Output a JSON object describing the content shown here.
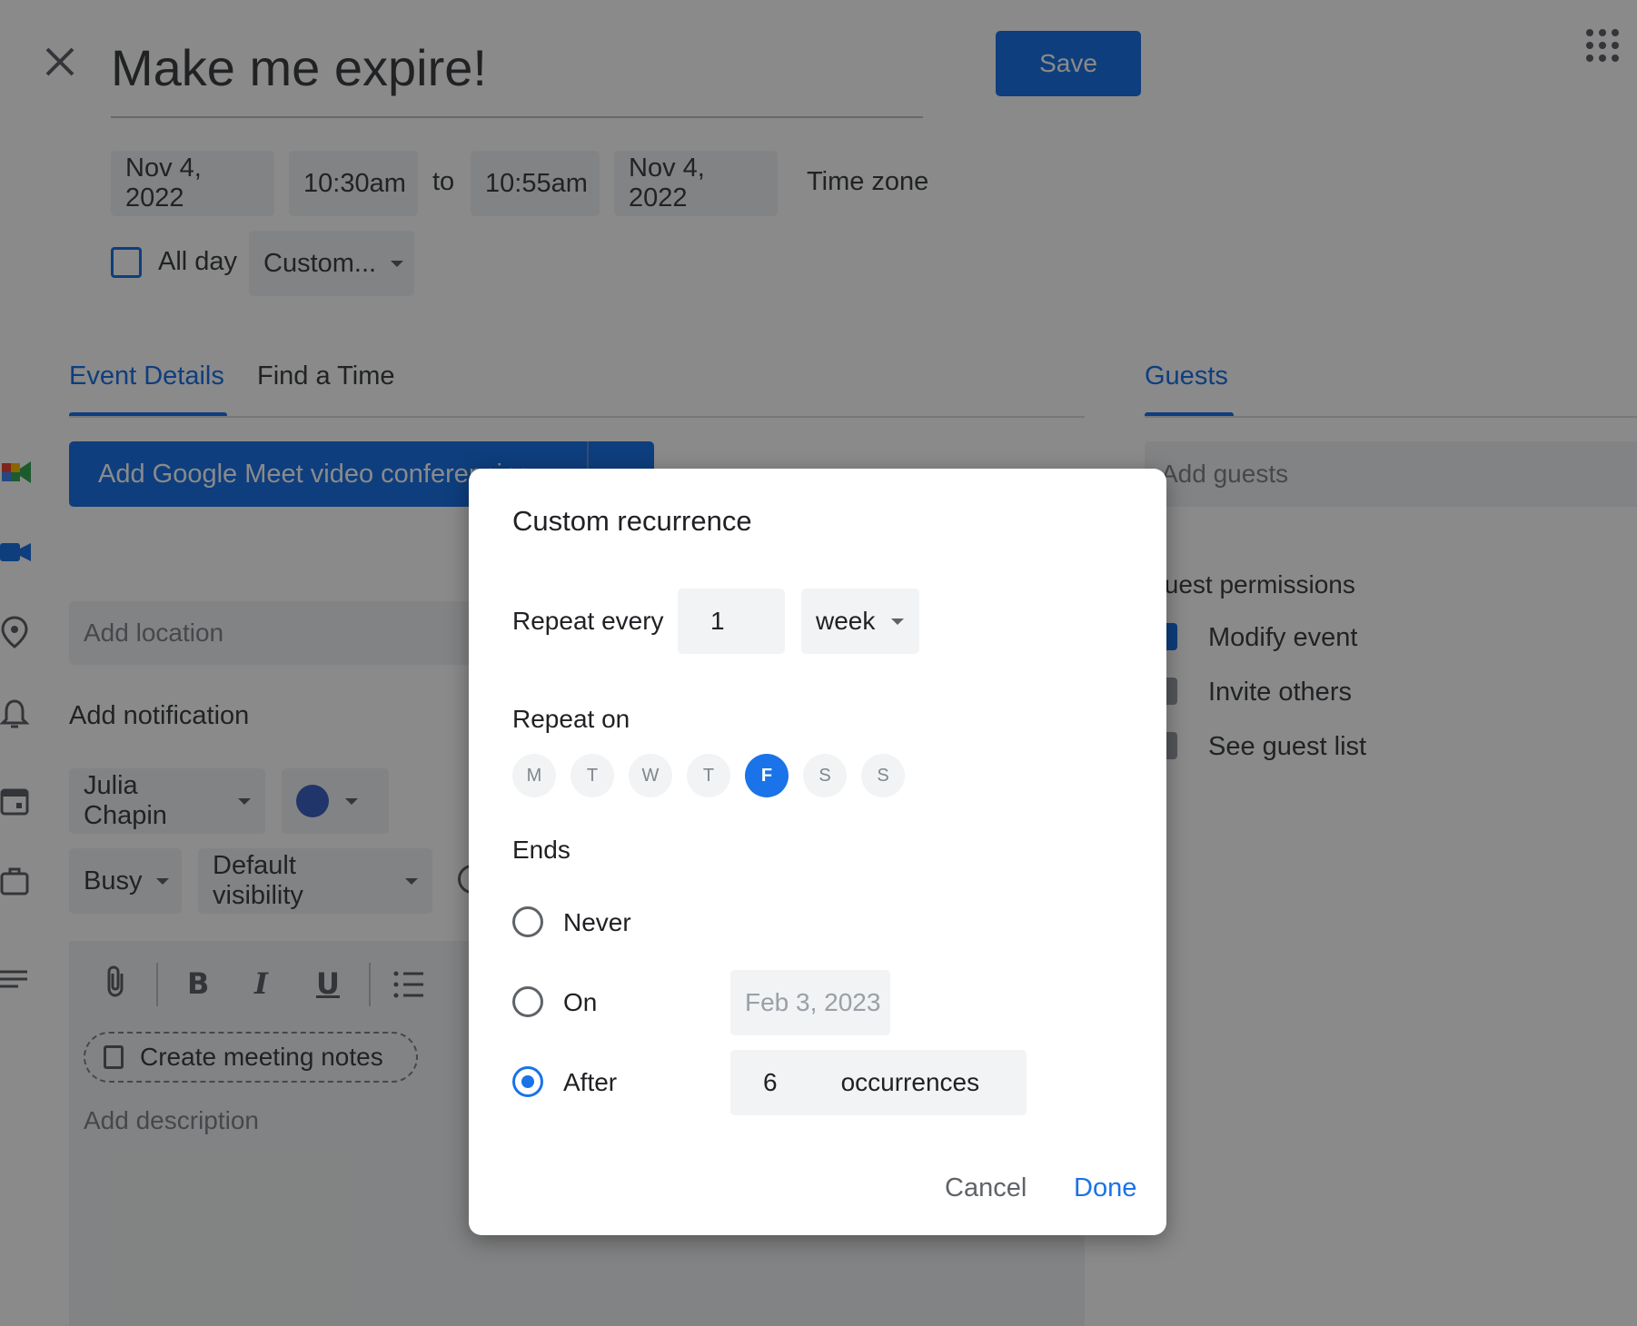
{
  "event": {
    "title": "Make me expire!",
    "save_label": "Save",
    "start_date": "Nov 4, 2022",
    "start_time": "10:30am",
    "to_label": "to",
    "end_time": "10:55am",
    "end_date": "Nov 4, 2022",
    "timezone_label": "Time zone",
    "all_day_label": "All day",
    "recurrence_value": "Custom..."
  },
  "tabs": {
    "event_details": "Event Details",
    "find_a_time": "Find a Time",
    "guests": "Guests"
  },
  "details": {
    "meet_button": "Add Google Meet video conferencing",
    "location_placeholder": "Add location",
    "notification_label": "Add notification",
    "calendar_owner": "Julia Chapin",
    "calendar_color": "#3b63c4",
    "availability": "Busy",
    "visibility": "Default visibility",
    "meeting_notes": "Create meeting notes",
    "description_placeholder": "Add description"
  },
  "guests": {
    "add_placeholder": "Add guests",
    "permissions_title": "Guest permissions",
    "permissions": [
      "Modify event",
      "Invite others",
      "See guest list"
    ]
  },
  "dialog": {
    "title": "Custom recurrence",
    "repeat_every_label": "Repeat every",
    "repeat_interval": "1",
    "repeat_unit": "week",
    "repeat_on_label": "Repeat on",
    "days": [
      {
        "letter": "M",
        "selected": false
      },
      {
        "letter": "T",
        "selected": false
      },
      {
        "letter": "W",
        "selected": false
      },
      {
        "letter": "T",
        "selected": false
      },
      {
        "letter": "F",
        "selected": true
      },
      {
        "letter": "S",
        "selected": false
      },
      {
        "letter": "S",
        "selected": false
      }
    ],
    "ends_label": "Ends",
    "ends_never": "Never",
    "ends_on": "On",
    "ends_on_date": "Feb 3, 2023",
    "ends_after": "After",
    "occurrences_count": "6",
    "occurrences_label": "occurrences",
    "selected_end": "After",
    "cancel_label": "Cancel",
    "done_label": "Done"
  },
  "colors": {
    "accent": "#1a73e8",
    "overlay": "rgba(0,0,0,0.46)"
  }
}
